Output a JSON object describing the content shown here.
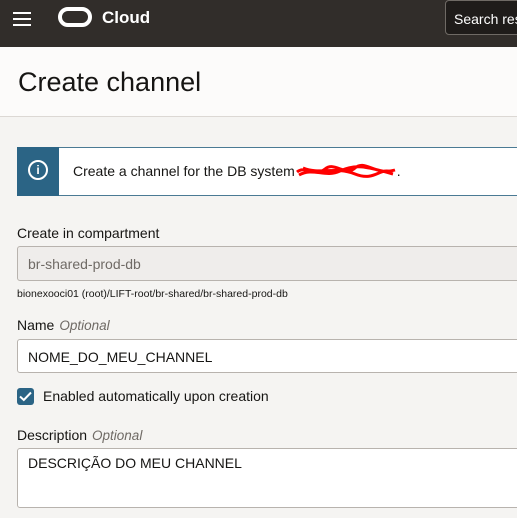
{
  "topbar": {
    "brand": "Cloud",
    "search_placeholder": "Search res"
  },
  "page": {
    "title": "Create channel"
  },
  "banner": {
    "text": "Create a channel for the DB system",
    "suffix": "."
  },
  "form": {
    "compartment": {
      "label": "Create in compartment",
      "value": "br-shared-prod-db",
      "path": "bionexooci01 (root)/LIFT-root/br-shared/br-shared-prod-db"
    },
    "name": {
      "label": "Name",
      "optional": "Optional",
      "value": "NOME_DO_MEU_CHANNEL"
    },
    "enabled": {
      "label": "Enabled automatically upon creation",
      "checked": true
    },
    "description": {
      "label": "Description",
      "optional": "Optional",
      "value": "DESCRIÇÃO DO MEU CHANNEL"
    }
  },
  "icons": {
    "menu": "hamburger-icon",
    "logo": "oracle-logo-icon",
    "info": "info-icon",
    "check": "check-icon"
  },
  "colors": {
    "topbar": "#312d2a",
    "accent": "#2b6485",
    "redaction": "#ff0000"
  }
}
